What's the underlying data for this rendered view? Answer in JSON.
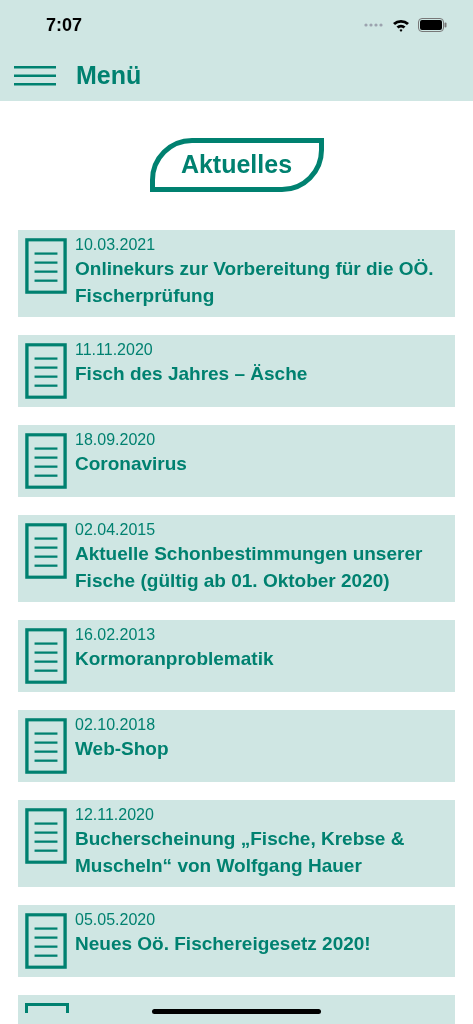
{
  "status_bar": {
    "time": "7:07"
  },
  "header": {
    "title": "Menü"
  },
  "section": {
    "title": "Aktuelles"
  },
  "news": [
    {
      "date": "10.03.2021",
      "title": "Onlinekurs zur Vorbereitung für die OÖ. Fischerprüfung"
    },
    {
      "date": "11.11.2020",
      "title": "Fisch des Jahres – Äsche"
    },
    {
      "date": "18.09.2020",
      "title": "Coronavirus"
    },
    {
      "date": "02.04.2015",
      "title": "Aktuelle Schonbestimmungen unserer Fische (gültig ab 01. Oktober 2020)"
    },
    {
      "date": "16.02.2013",
      "title": "Kormoranproblematik"
    },
    {
      "date": "02.10.2018",
      "title": "Web-Shop"
    },
    {
      "date": "12.11.2020",
      "title": "Bucherscheinung „Fische, Krebse & Muscheln“ von Wolfgang Hauer"
    },
    {
      "date": "05.05.2020",
      "title": "Neues Oö. Fischereigesetz 2020!"
    }
  ]
}
